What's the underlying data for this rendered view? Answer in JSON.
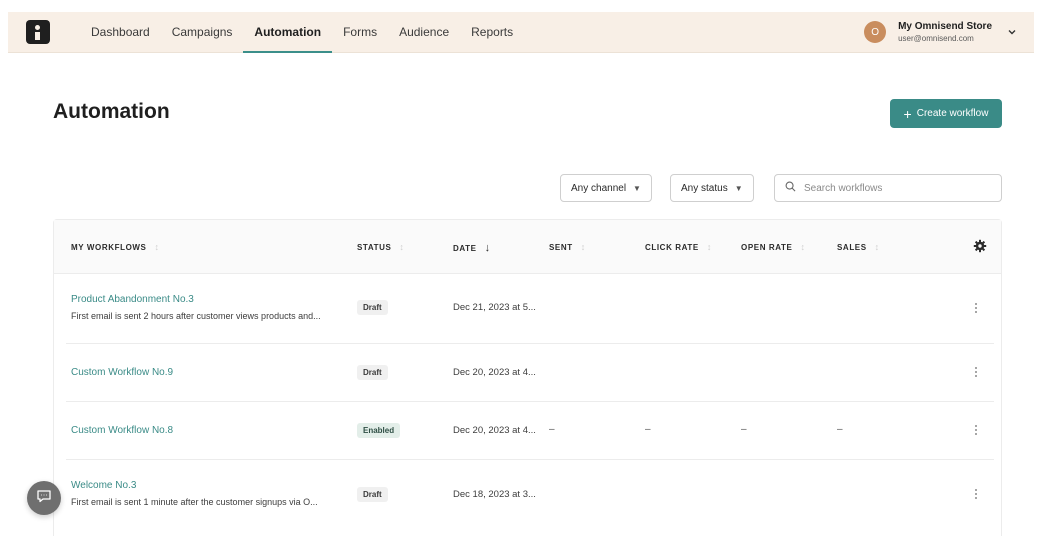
{
  "colors": {
    "accent": "#3a8b87",
    "topbar_bg": "#f8efe6"
  },
  "nav": {
    "items": [
      {
        "label": "Dashboard"
      },
      {
        "label": "Campaigns"
      },
      {
        "label": "Automation",
        "active": true
      },
      {
        "label": "Forms"
      },
      {
        "label": "Audience"
      },
      {
        "label": "Reports"
      }
    ]
  },
  "account": {
    "initial": "O",
    "store_name": "My Omnisend Store",
    "email": "user@omnisend.com"
  },
  "page": {
    "title": "Automation",
    "create_button": "Create workflow"
  },
  "filters": {
    "channel": "Any channel",
    "status": "Any status",
    "search_placeholder": "Search workflows"
  },
  "table": {
    "columns": [
      "MY WORKFLOWS",
      "STATUS",
      "DATE",
      "SENT",
      "CLICK RATE",
      "OPEN RATE",
      "SALES"
    ],
    "sorted_column": "DATE",
    "rows": [
      {
        "name": "Product Abandonment No.3",
        "description": "First email is sent 2 hours after customer views products and...",
        "status": "Draft",
        "date": "Dec 21, 2023 at 5...",
        "sent": "",
        "click_rate": "",
        "open_rate": "",
        "sales": ""
      },
      {
        "name": "Custom Workflow No.9",
        "description": "",
        "status": "Draft",
        "date": "Dec 20, 2023 at 4...",
        "sent": "",
        "click_rate": "",
        "open_rate": "",
        "sales": ""
      },
      {
        "name": "Custom Workflow No.8",
        "description": "",
        "status": "Enabled",
        "date": "Dec 20, 2023 at 4...",
        "sent": "–",
        "click_rate": "–",
        "open_rate": "–",
        "sales": "–"
      },
      {
        "name": "Welcome No.3",
        "description": "First email is sent 1 minute after the customer signups via O...",
        "status": "Draft",
        "date": "Dec 18, 2023 at 3...",
        "sent": "",
        "click_rate": "",
        "open_rate": "",
        "sales": ""
      }
    ]
  },
  "icons": [
    "logo-icon",
    "chevron-down-icon",
    "plus-icon",
    "search-icon",
    "sort-icon",
    "settings-gear-icon",
    "more-vertical-icon",
    "chat-icon"
  ]
}
